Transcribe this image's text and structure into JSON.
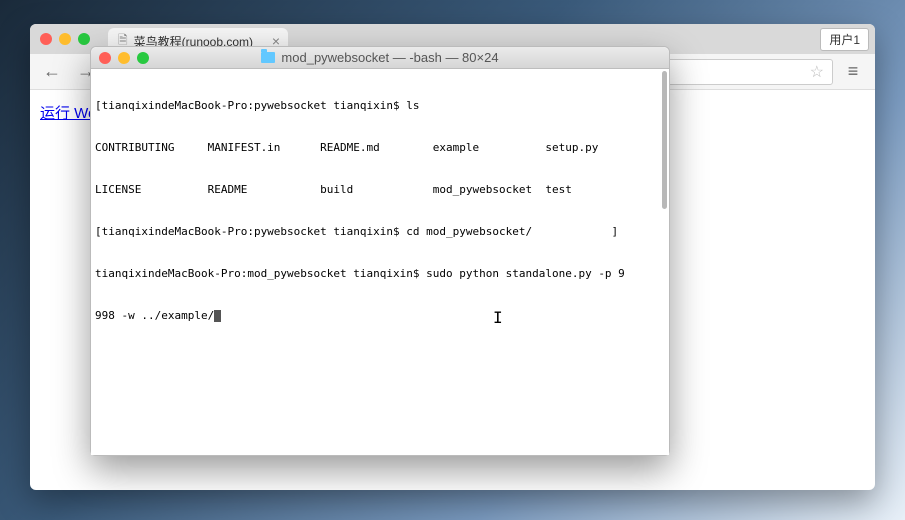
{
  "browser": {
    "tab": {
      "title": "菜鸟教程(runoob.com)"
    },
    "user_label": "用户1",
    "page": {
      "link_text": "运行 We"
    }
  },
  "terminal": {
    "title": "mod_pywebsocket — -bash — 80×24",
    "lines": [
      "[tianqixindeMacBook-Pro:pywebsocket tianqixin$ ls",
      "CONTRIBUTING     MANIFEST.in      README.md        example          setup.py",
      "LICENSE          README           build            mod_pywebsocket  test",
      "[tianqixindeMacBook-Pro:pywebsocket tianqixin$ cd mod_pywebsocket/            ]",
      "tianqixindeMacBook-Pro:mod_pywebsocket tianqixin$ sudo python standalone.py -p 9",
      "998 -w ../example/"
    ]
  }
}
